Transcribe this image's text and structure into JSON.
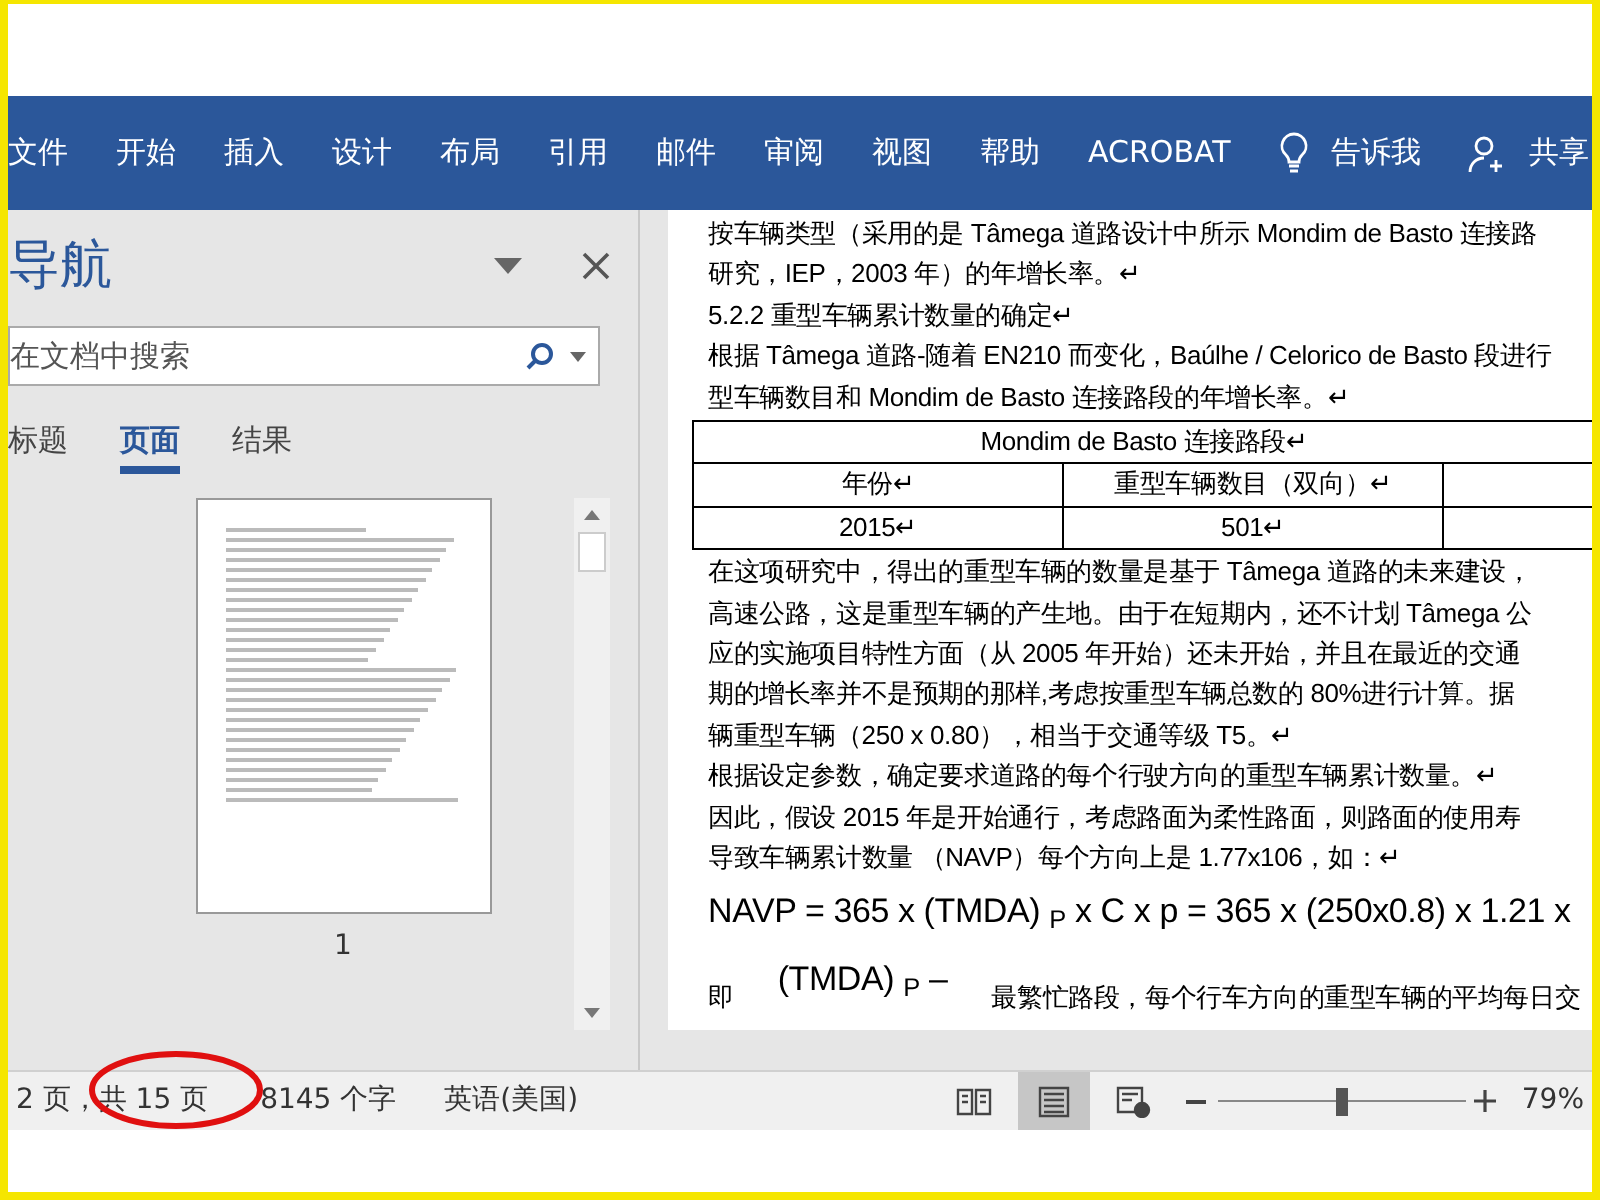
{
  "ribbon_tabs": [
    {
      "label": "文件",
      "kind": "tab"
    },
    {
      "label": "开始",
      "kind": "tab"
    },
    {
      "label": "插入",
      "kind": "tab"
    },
    {
      "label": "设计",
      "kind": "tab"
    },
    {
      "label": "布局",
      "kind": "tab"
    },
    {
      "label": "引用",
      "kind": "tab"
    },
    {
      "label": "邮件",
      "kind": "tab"
    },
    {
      "label": "审阅",
      "kind": "tab"
    },
    {
      "label": "视图",
      "kind": "tab"
    },
    {
      "label": "帮助",
      "kind": "tab"
    },
    {
      "label": "ACROBAT",
      "kind": "tab"
    },
    {
      "label": "告诉我",
      "kind": "tellme"
    },
    {
      "label": "共享",
      "kind": "share"
    }
  ],
  "navigation": {
    "title": "导航",
    "search": {
      "placeholder": "在文档中搜索"
    },
    "tabs": [
      {
        "label": "标题",
        "selected": false
      },
      {
        "label": "页面",
        "selected": true
      },
      {
        "label": "结果",
        "selected": false
      }
    ],
    "thumbnail": {
      "page_number": "1"
    }
  },
  "document": {
    "blocks": [
      {
        "kind": "line",
        "text": "按车辆类型（采用的是 Tâmega 道路设计中所示 Mondim de Basto 连接路"
      },
      {
        "kind": "line",
        "text": "研究，IEP，2003 年）的年增长率。↵"
      },
      {
        "kind": "line",
        "text": "5.2.2  重型车辆累计数量的确定↵"
      },
      {
        "kind": "line",
        "text": "根据 Tâmega 道路-随着 EN210 而变化，Baúlhe / Celorico de Basto 段进行"
      },
      {
        "kind": "line",
        "text": "型车辆数目和 Mondim de Basto 连接路段的年增长率。↵"
      },
      {
        "kind": "table",
        "header": "Mondim de Basto 连接路段↵",
        "rows": [
          [
            "年份↵",
            "重型车辆数目（双向）↵"
          ],
          [
            "2015↵",
            "501↵"
          ]
        ]
      },
      {
        "kind": "line",
        "text": "在这项研究中，得出的重型车辆的数量是基于 Tâmega 道路的未来建设，"
      },
      {
        "kind": "line",
        "text": "高速公路，这是重型车辆的产生地。由于在短期内，还不计划 Tâmega 公"
      },
      {
        "kind": "line",
        "text": "应的实施项目特性方面（从 2005 年开始）还未开始，并且在最近的交通"
      },
      {
        "kind": "line",
        "text": "期的增长率并不是预期的那样,考虑按重型车辆总数的 80%进行计算。据"
      },
      {
        "kind": "line",
        "text": "辆重型车辆（250 x 0.80），相当于交通等级 T5。↵"
      },
      {
        "kind": "line",
        "text": "根据设定参数，确定要求道路的每个行驶方向的重型车辆累计数量。↵"
      },
      {
        "kind": "line",
        "text": "因此，假设 2015 年是开始通行，考虑路面为柔性路面，则路面的使用寿"
      },
      {
        "kind": "line",
        "text": "导致车辆累计数量 （NAVP）每个方向上是 1.77x106，如：↵"
      },
      {
        "kind": "formula",
        "text": "NAVP = 365 x (TMDA) $_{P}$ x C x p = 365 x (250x0.8) x 1.21 x"
      },
      {
        "kind": "definition",
        "lead": "即",
        "term": "(TMDA) $_{P}$ –",
        "text": "最繁忙路段，每个行车方向的重型车辆的平均每日交"
      }
    ]
  },
  "status_bar": {
    "page": "2 页，共 15 页",
    "words": "8145 个字",
    "language": "英语(美国)",
    "views": [
      {
        "kind": "read",
        "selected": false
      },
      {
        "kind": "print",
        "selected": true
      },
      {
        "kind": "web",
        "selected": false
      }
    ],
    "zoom": {
      "level": 0.5,
      "reading": "79%"
    }
  }
}
